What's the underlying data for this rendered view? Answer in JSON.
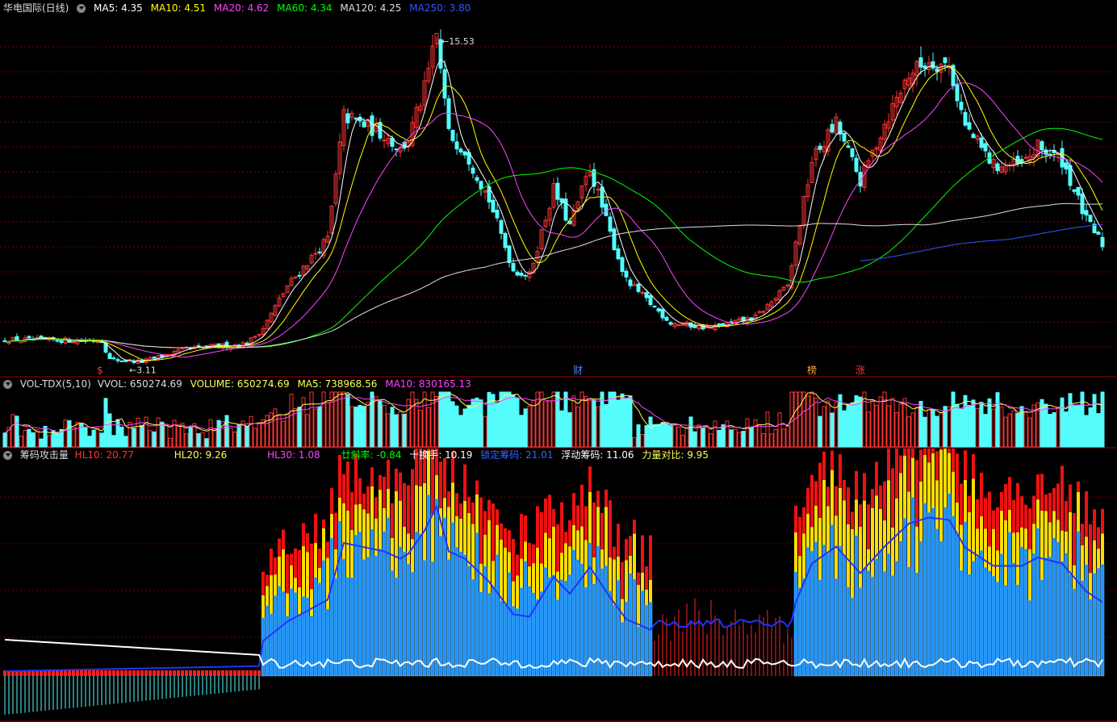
{
  "main": {
    "stock": "华电国际(日线)",
    "ma": [
      {
        "label": "MA5: 4.35",
        "color": "#ffffff"
      },
      {
        "label": "MA10: 4.51",
        "color": "#ffff00"
      },
      {
        "label": "MA20: 4.62",
        "color": "#ff44ff"
      },
      {
        "label": "MA60: 4.34",
        "color": "#00ff00"
      },
      {
        "label": "MA120: 4.25",
        "color": "#dddddd"
      },
      {
        "label": "MA250: 3.80",
        "color": "#3355ff"
      }
    ],
    "high_label": "15.53",
    "low_label": "3.11",
    "markers": [
      {
        "label": "$",
        "day": 24,
        "color": "#ff3333"
      },
      {
        "label": "财",
        "day": 142,
        "color": "#4488ff"
      },
      {
        "label": "榜",
        "day": 200,
        "color": "#ffaa33"
      },
      {
        "label": "涨",
        "day": 212,
        "color": "#ff3333"
      }
    ]
  },
  "vol": {
    "title": "VOL-TDX(5,10)",
    "vvol": "VVOL: 650274.69",
    "volume": "VOLUME: 650274.69",
    "ma5": "MA5: 738968.56",
    "ma10": "MA10: 830165.13"
  },
  "chip": {
    "title": "筹码攻击量",
    "items": [
      {
        "label": "HL10: 20.77",
        "color": "#ff3333"
      },
      {
        "label": "HL20: 9.26",
        "color": "#ffff55"
      },
      {
        "label": "HL30: 1.08",
        "color": "#ff44ff"
      },
      {
        "label": "廿斜率: -0.84",
        "color": "#00ff00"
      },
      {
        "label": "十换手: 10.19",
        "color": "#ffffff"
      },
      {
        "label": "锁定筹码: 21.01",
        "color": "#3366ff"
      },
      {
        "label": "浮动筹码: 11.06",
        "color": "#ffffff"
      },
      {
        "label": "力量对比: 9.95",
        "color": "#ffff55"
      }
    ]
  },
  "colors": {
    "up": "#ff3333",
    "down": "#54fcfc",
    "bg": "#000000",
    "grid": "#7a0000"
  },
  "chart_data": {
    "type": "candlestick",
    "days": 273,
    "price_ylim": [
      3.0,
      16.3
    ],
    "keypoints": [
      [
        0,
        3.95
      ],
      [
        24,
        3.92
      ],
      [
        26,
        3.2
      ],
      [
        34,
        3.11
      ],
      [
        45,
        3.6
      ],
      [
        60,
        3.8
      ],
      [
        64,
        4.4
      ],
      [
        70,
        6.0
      ],
      [
        80,
        7.8
      ],
      [
        84,
        12.5
      ],
      [
        94,
        11.8
      ],
      [
        98,
        11.2
      ],
      [
        100,
        11.6
      ],
      [
        104,
        13.5
      ],
      [
        107,
        15.53
      ],
      [
        110,
        11.8
      ],
      [
        114,
        11.2
      ],
      [
        120,
        9.3
      ],
      [
        126,
        6.6
      ],
      [
        130,
        6.4
      ],
      [
        136,
        9.7
      ],
      [
        140,
        8.3
      ],
      [
        145,
        10.5
      ],
      [
        150,
        8.0
      ],
      [
        154,
        6.2
      ],
      [
        165,
        4.6
      ],
      [
        175,
        4.4
      ],
      [
        186,
        4.8
      ],
      [
        194,
        6.0
      ],
      [
        200,
        10.8
      ],
      [
        206,
        12.2
      ],
      [
        212,
        10.0
      ],
      [
        218,
        12.2
      ],
      [
        224,
        14.1
      ],
      [
        229,
        14.6
      ],
      [
        234,
        14.4
      ],
      [
        238,
        12.1
      ],
      [
        245,
        10.6
      ],
      [
        252,
        10.6
      ],
      [
        256,
        11.3
      ],
      [
        262,
        10.8
      ],
      [
        268,
        8.5
      ],
      [
        272,
        7.6
      ]
    ],
    "volume_notes": "daily volume bars with MA5/MA10; last VOLUME 650274.69",
    "chip_notes": "stacked red/yellow/blue bars with blue and white lines"
  }
}
